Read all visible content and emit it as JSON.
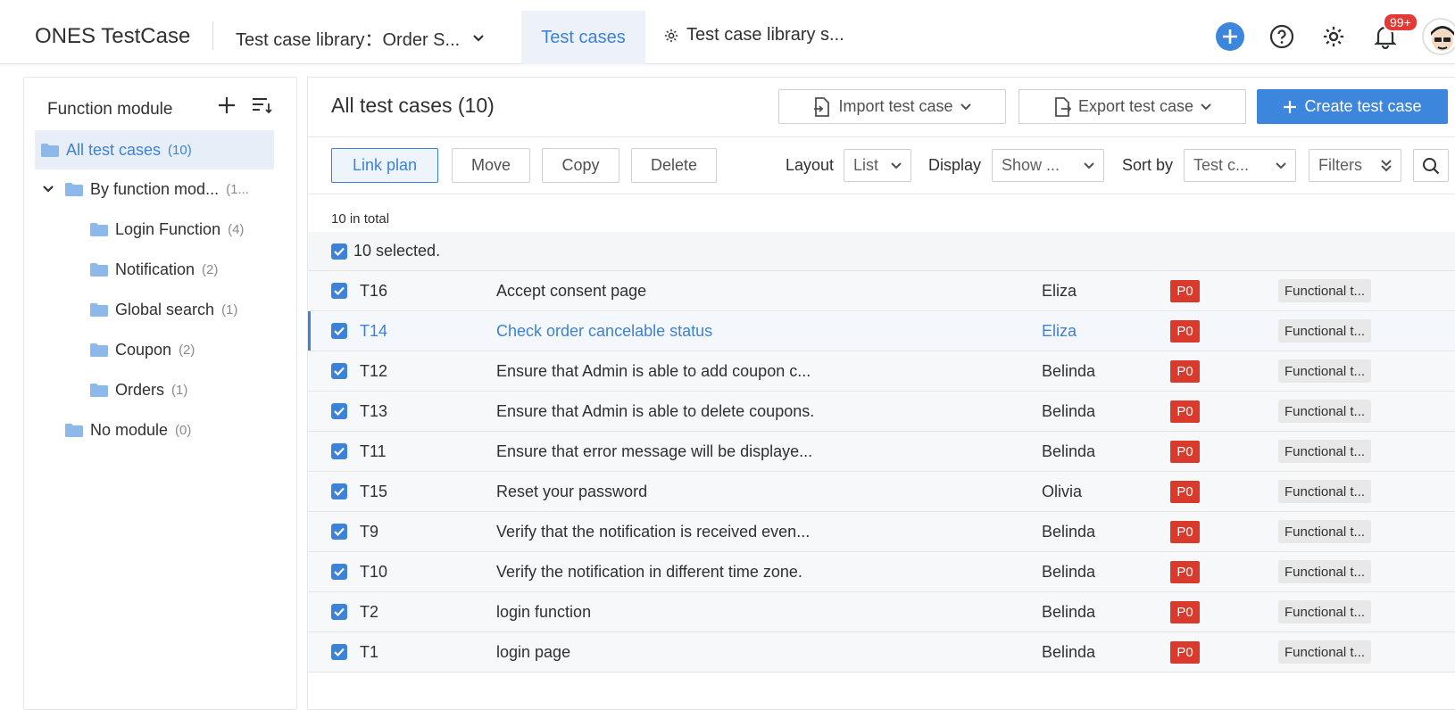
{
  "app": {
    "title": "ONES TestCase"
  },
  "nav": {
    "library_label": "Test case library：Order S...",
    "active_tab": "Test cases",
    "settings_tab": "Test case library s...",
    "notification_badge": "99+"
  },
  "colors": {
    "accent": "#3b82d8",
    "primary_button": "#3d86dd",
    "priority_red": "#d93a2b",
    "badge_red": "#e53935"
  },
  "sidebar": {
    "header": "Function module",
    "items": [
      {
        "label": "All test cases",
        "count": "(10)"
      },
      {
        "label": "By function mod...",
        "count": "(1..."
      },
      {
        "label": "Login Function",
        "count": "(4)"
      },
      {
        "label": "Notification",
        "count": "(2)"
      },
      {
        "label": "Global search",
        "count": "(1)"
      },
      {
        "label": "Coupon",
        "count": "(2)"
      },
      {
        "label": "Orders",
        "count": "(1)"
      },
      {
        "label": "No module",
        "count": "(0)"
      }
    ]
  },
  "main": {
    "title": "All test cases (10)",
    "import_label": "Import test case",
    "export_label": "Export test case",
    "create_label": "Create test case",
    "actions": {
      "link_plan": "Link plan",
      "move": "Move",
      "copy": "Copy",
      "delete": "Delete"
    },
    "layout_label": "Layout",
    "layout_value": "List",
    "display_label": "Display",
    "display_value": "Show ...",
    "sort_label": "Sort by",
    "sort_value": "Test c...",
    "filters_label": "Filters",
    "total_text": "10 in total",
    "selected_text": "10 selected."
  },
  "rows": [
    {
      "id": "T16",
      "title": "Accept consent page",
      "owner": "Eliza",
      "priority": "P0",
      "type": "Functional t..."
    },
    {
      "id": "T14",
      "title": "Check order cancelable status",
      "owner": "Eliza",
      "priority": "P0",
      "type": "Functional t..."
    },
    {
      "id": "T12",
      "title": "Ensure that Admin is able to add coupon c...",
      "owner": "Belinda",
      "priority": "P0",
      "type": "Functional t..."
    },
    {
      "id": "T13",
      "title": "Ensure that Admin is able to delete coupons.",
      "owner": "Belinda",
      "priority": "P0",
      "type": "Functional t..."
    },
    {
      "id": "T11",
      "title": "Ensure that error message will be displaye...",
      "owner": "Belinda",
      "priority": "P0",
      "type": "Functional t..."
    },
    {
      "id": "T15",
      "title": "Reset your password",
      "owner": "Olivia",
      "priority": "P0",
      "type": "Functional t..."
    },
    {
      "id": "T9",
      "title": "Verify that the notification is received even...",
      "owner": "Belinda",
      "priority": "P0",
      "type": "Functional t..."
    },
    {
      "id": "T10",
      "title": "Verify the notification in different time zone.",
      "owner": "Belinda",
      "priority": "P0",
      "type": "Functional t..."
    },
    {
      "id": "T2",
      "title": "login function",
      "owner": "Belinda",
      "priority": "P0",
      "type": "Functional t..."
    },
    {
      "id": "T1",
      "title": "login page",
      "owner": "Belinda",
      "priority": "P0",
      "type": "Functional t..."
    }
  ]
}
